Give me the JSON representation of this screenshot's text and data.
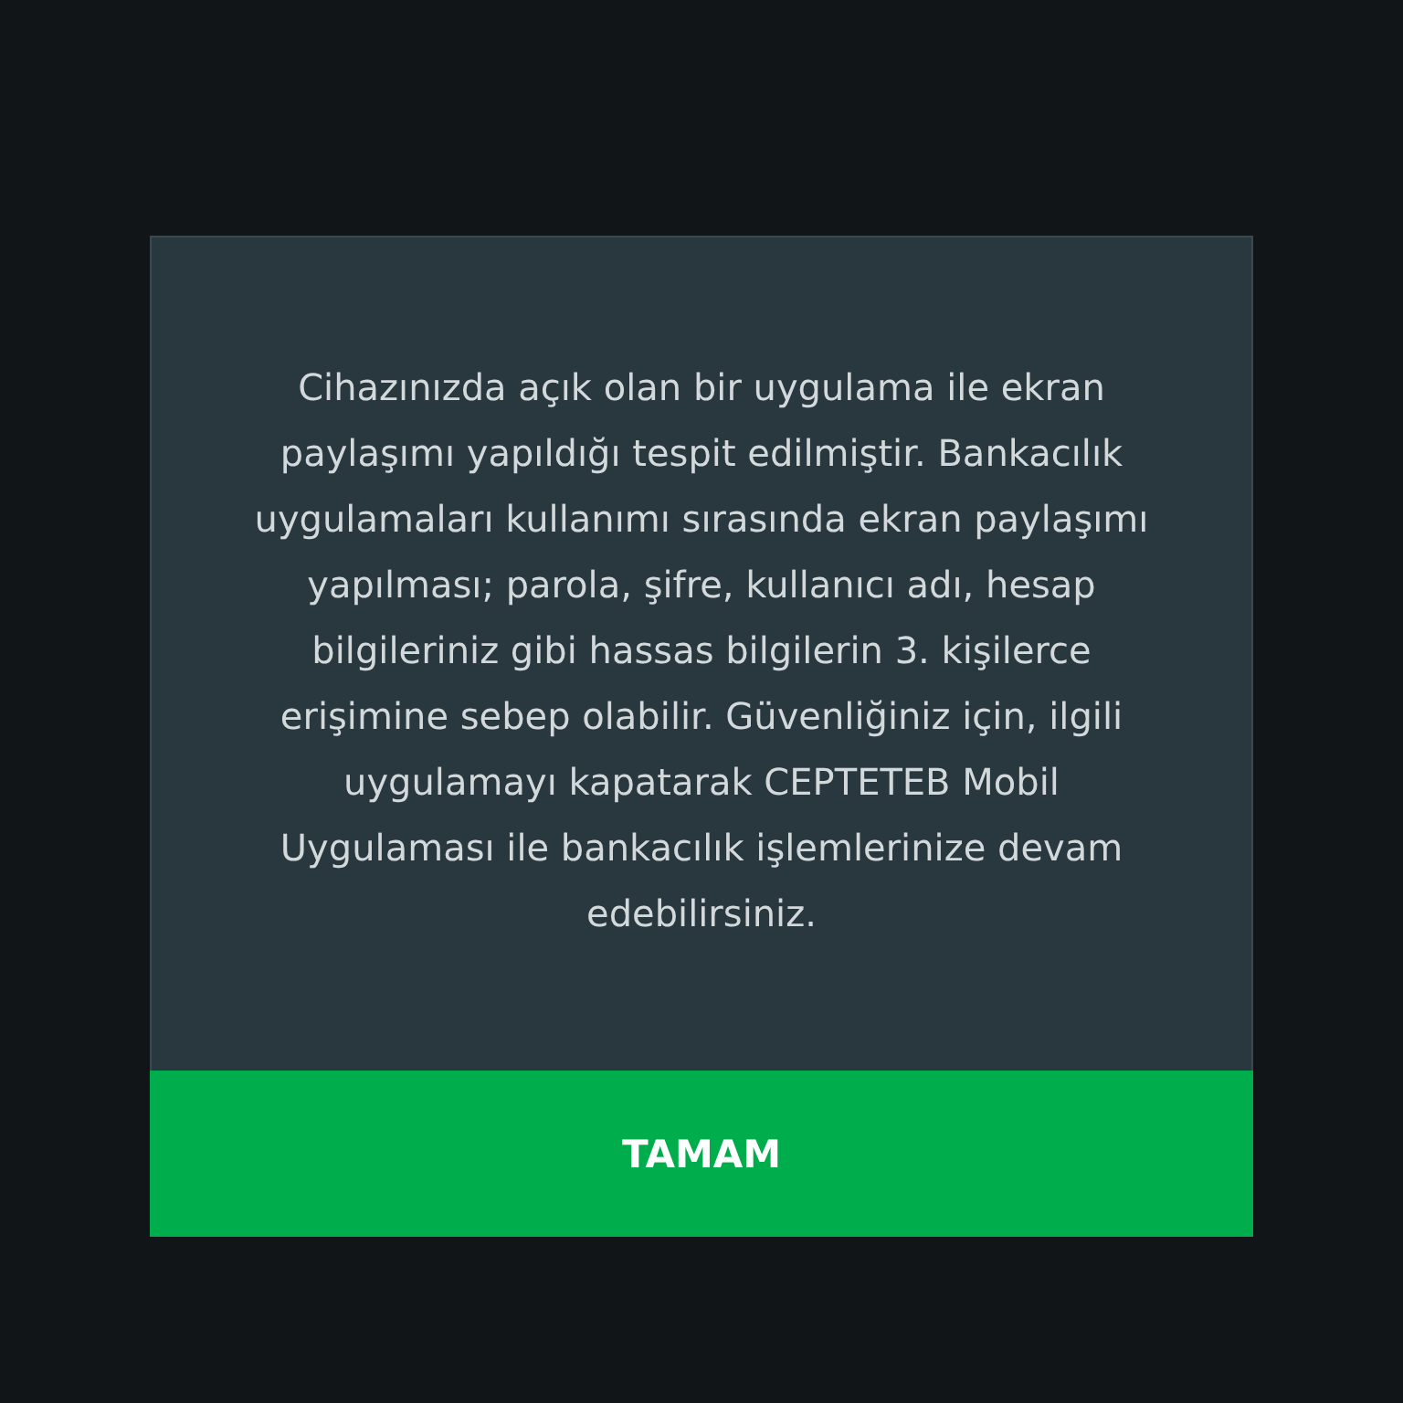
{
  "dialog": {
    "message": "Cihazınızda açık olan bir uygulama ile ekran paylaşımı yapıldığı tespit edilmiştir. Bankacılık uygulamaları kullanımı sırasında ekran paylaşımı yapılması; parola, şifre, kullanıcı adı, hesap bilgileriniz gibi hassas bilgilerin 3. kişilerce erişimine sebep olabilir. Güvenliğiniz için, ilgili uygulamayı kapatarak CEPTETEB Mobil Uygulaması ile bankacılık işlemlerinize devam edebilirsiniz.",
    "button": "TAMAM"
  }
}
